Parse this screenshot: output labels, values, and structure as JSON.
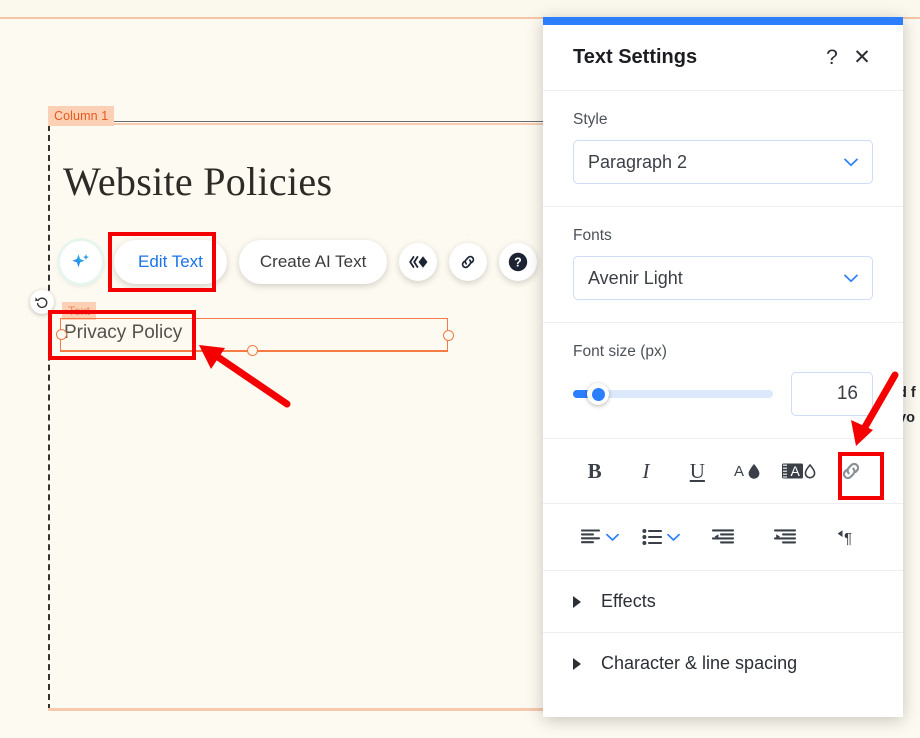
{
  "canvas": {
    "column_tag": "Column 1",
    "heading": "Website Policies",
    "element_tag": "Text",
    "selected_text": "Privacy Policy",
    "toolbar": {
      "ai_icon": "ai-sparkle-icon",
      "edit_text_label": "Edit Text",
      "create_ai_text_label": "Create AI Text",
      "animation_icon": "animation-icon",
      "link_icon": "link-icon",
      "help_icon": "help-icon"
    },
    "undo_icon": "undo-icon",
    "behind_panel_text_line1": "d f",
    "behind_panel_text_line2": "vo"
  },
  "panel": {
    "title": "Text Settings",
    "help_label": "?",
    "close_label": "✕",
    "style": {
      "label": "Style",
      "value": "Paragraph 2"
    },
    "fonts": {
      "label": "Fonts",
      "value": "Avenir Light"
    },
    "font_size": {
      "label": "Font size (px)",
      "value": "16"
    },
    "format_tools": [
      {
        "name": "bold-icon",
        "glyph": "B"
      },
      {
        "name": "italic-icon",
        "glyph": "I"
      },
      {
        "name": "underline-icon",
        "glyph": "U"
      },
      {
        "name": "text-color-icon",
        "glyph": ""
      },
      {
        "name": "highlight-color-icon",
        "glyph": ""
      },
      {
        "name": "link-icon",
        "glyph": ""
      }
    ],
    "paragraph_tools": [
      {
        "name": "align-left-icon"
      },
      {
        "name": "bullet-list-icon"
      },
      {
        "name": "decrease-indent-icon"
      },
      {
        "name": "increase-indent-icon"
      },
      {
        "name": "text-direction-icon"
      }
    ],
    "accordions": [
      {
        "label": "Effects"
      },
      {
        "label": "Character & line spacing"
      }
    ]
  },
  "colors": {
    "accent_blue": "#2b7fff",
    "annotation_red": "#f40000",
    "canvas_bg": "#fdfaf1",
    "selection_orange": "#f47b45",
    "tag_bg": "#fbd0b4"
  }
}
